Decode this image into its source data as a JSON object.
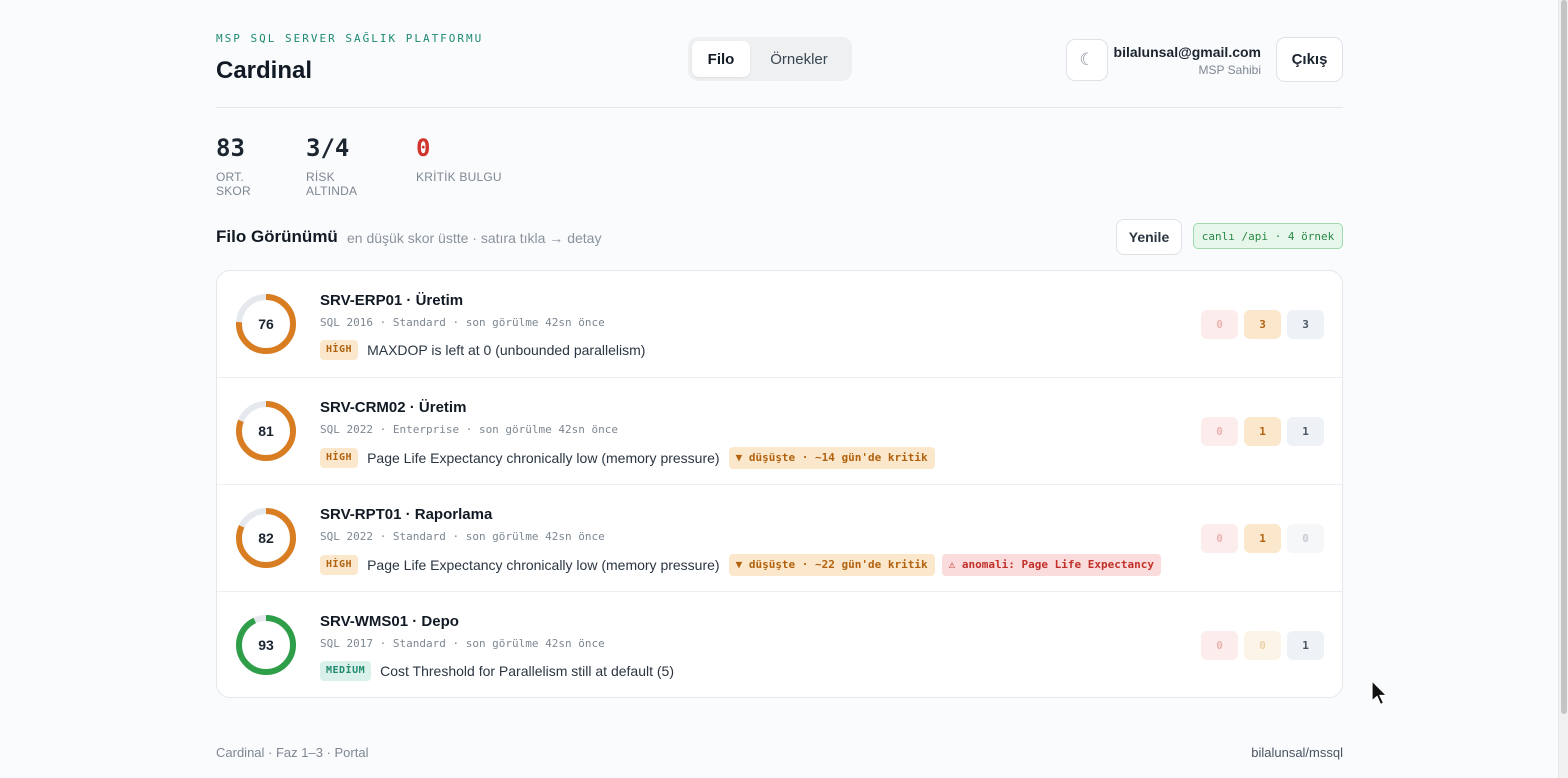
{
  "header": {
    "kicker": "MSP SQL SERVER SAĞLIK PLATFORMU",
    "title": "Cardinal",
    "tabs": [
      {
        "label": "Filo",
        "active": true
      },
      {
        "label": "Örnekler",
        "active": false
      }
    ],
    "theme_toggle": "☾",
    "user_email": "bilalunsal@gmail.com",
    "user_role": "MSP Sahibi",
    "logout_label": "Çıkış"
  },
  "stats": [
    {
      "value": "83",
      "label": "ORT. SKOR",
      "tone": "normal"
    },
    {
      "value": "3/4",
      "label": "RİSK ALTINDA",
      "tone": "normal"
    },
    {
      "value": "0",
      "label": "KRİTİK BULGU",
      "tone": "danger"
    }
  ],
  "section": {
    "title": "Filo Görünümü",
    "subtitle": "en düşük skor üstte · satıra tıkla → detay",
    "refresh_label": "Yenile",
    "live_badge": "canlı /api · 4 örnek"
  },
  "servers": [
    {
      "score": 76,
      "status": "warn",
      "name": "SRV-ERP01 · Üretim",
      "meta": "SQL 2016 · Standard · son görülme 42sn önce",
      "severity": "HİGH",
      "severity_level": "high",
      "finding": "MAXDOP is left at 0 (unbounded parallelism)",
      "trend": "",
      "anomaly": "",
      "counts": {
        "critical": 0,
        "high": 3,
        "medium": 3
      }
    },
    {
      "score": 81,
      "status": "warn",
      "name": "SRV-CRM02 · Üretim",
      "meta": "SQL 2022 · Enterprise · son görülme 42sn önce",
      "severity": "HİGH",
      "severity_level": "high",
      "finding": "Page Life Expectancy chronically low (memory pressure)",
      "trend": "▼ düşüşte · ~14 gün'de kritik",
      "anomaly": "",
      "counts": {
        "critical": 0,
        "high": 1,
        "medium": 1
      }
    },
    {
      "score": 82,
      "status": "warn",
      "name": "SRV-RPT01 · Raporlama",
      "meta": "SQL 2022 · Standard · son görülme 42sn önce",
      "severity": "HİGH",
      "severity_level": "high",
      "finding": "Page Life Expectancy chronically low (memory pressure)",
      "trend": "▼ düşüşte · ~22 gün'de kritik",
      "anomaly": "⚠ anomali: Page Life Expectancy",
      "counts": {
        "critical": 0,
        "high": 1,
        "medium": 0
      }
    },
    {
      "score": 93,
      "status": "good",
      "name": "SRV-WMS01 · Depo",
      "meta": "SQL 2017 · Standard · son görülme 42sn önce",
      "severity": "MEDİUM",
      "severity_level": "medium",
      "finding": "Cost Threshold for Parallelism still at default (5)",
      "trend": "",
      "anomaly": "",
      "counts": {
        "critical": 0,
        "high": 0,
        "medium": 1
      }
    }
  ],
  "footer": {
    "left": "Cardinal · Faz 1–3 · Portal",
    "right": "bilalunsal/mssql"
  },
  "colors": {
    "accent": "#1d8a73",
    "warn_ring": "#d97d22",
    "good_ring": "#2f9e48",
    "ring_track": "#e5e8ed",
    "danger": "#d0342c"
  }
}
